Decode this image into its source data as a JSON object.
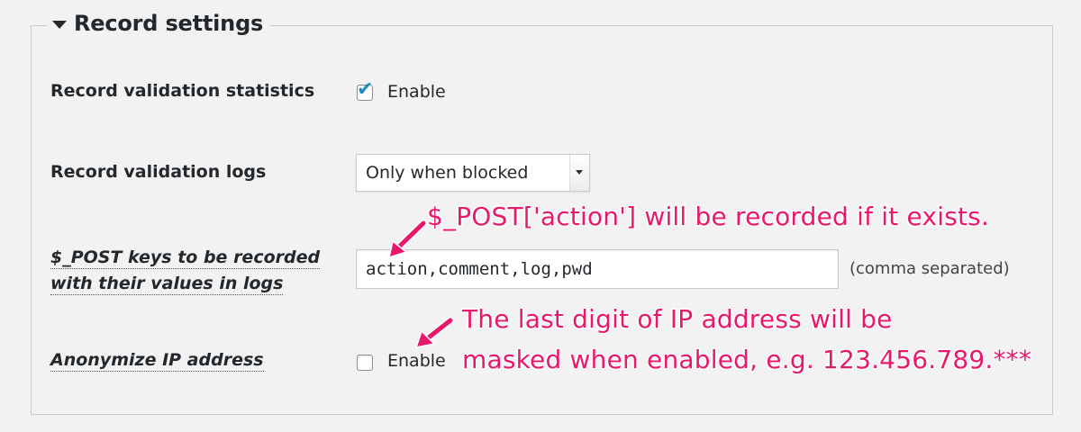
{
  "section": {
    "title": "Record settings",
    "collapse_icon": "triangle-down-icon"
  },
  "rows": {
    "stats": {
      "label": "Record validation statistics",
      "checked": true,
      "checkbox_label": "Enable"
    },
    "logs": {
      "label": "Record validation logs",
      "selected": "Only when blocked"
    },
    "post_keys": {
      "label_line1": "$_POST keys to be recorded",
      "label_line2": "with their values in logs",
      "value": "action,comment,log,pwd",
      "hint": "(comma separated)"
    },
    "anonymize": {
      "label": "Anonymize IP address",
      "checked": false,
      "checkbox_label": "Enable"
    }
  },
  "annotations": {
    "post_note": "$_POST['action'] will be recorded if it exists.",
    "ip_note_line1": "The last digit of IP address will be",
    "ip_note_line2": "masked when enabled, e.g. 123.456.789.***",
    "color": "#e8196a"
  },
  "colors": {
    "background": "#f2f2f2",
    "checkmark": "#1e8cbe",
    "border": "#c9c9c9"
  }
}
